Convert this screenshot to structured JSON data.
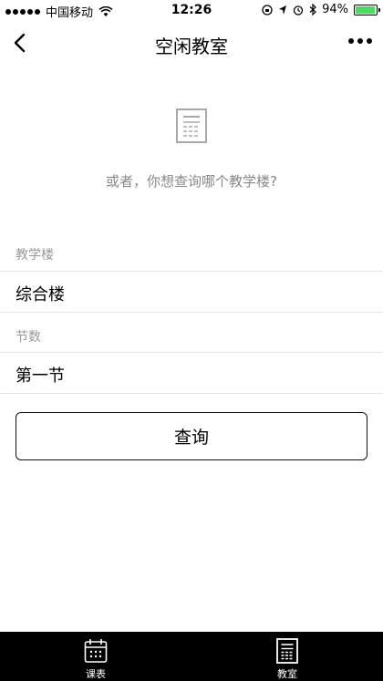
{
  "status_bar": {
    "carrier": "中国移动",
    "time": "12:26",
    "battery": "94%",
    "battery_level": 0.94,
    "icons": [
      "signal-dots-icon",
      "wifi-icon",
      "orientation-lock-icon",
      "location-icon",
      "alarm-icon",
      "bluetooth-icon",
      "battery-icon"
    ]
  },
  "nav": {
    "title": "空闲教室",
    "back_icon": "chevron-left-icon",
    "more_icon": "more-dots-icon"
  },
  "empty_state": {
    "icon": "document-list-icon",
    "message": "或者，你想查询哪个教学楼?"
  },
  "form": {
    "building_label": "教学楼",
    "building_value": "综合楼",
    "period_label": "节数",
    "period_value": "第一节",
    "submit_label": "查询"
  },
  "tab_bar": {
    "tabs": [
      {
        "label": "课表",
        "icon": "calendar-icon"
      },
      {
        "label": "教室",
        "icon": "classroom-icon"
      }
    ]
  },
  "colors": {
    "accent": "#000000",
    "muted_text": "#888888",
    "battery_fill": "#4cd964",
    "tab_bar_bg": "#000000"
  }
}
